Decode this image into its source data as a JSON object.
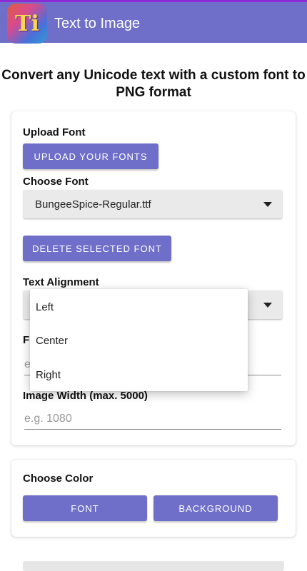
{
  "app": {
    "title": "Text to Image",
    "icon_glyph": "Ti"
  },
  "headline": "Convert any Unicode text with a custom font to PNG format",
  "upload": {
    "label": "Upload Font",
    "button": "UPLOAD YOUR FONTS"
  },
  "choose_font": {
    "label": "Choose Font",
    "selected": "BungeeSpice-Regular.ttf"
  },
  "delete_button": "DELETE SELECTED FONT",
  "alignment": {
    "label": "Text Alignment",
    "options": [
      "Left",
      "Center",
      "Right"
    ]
  },
  "font_size": {
    "label_partial": "F",
    "placeholder_partial": "e"
  },
  "image_width": {
    "label": "Image Width (max. 5000)",
    "placeholder": "e.g. 1080"
  },
  "color": {
    "label": "Choose Color",
    "font_button": "FONT",
    "background_button": "BACKGROUND"
  },
  "colors": {
    "accent": "#6f6fc9",
    "topbar_edge": "#8b2bd6"
  }
}
